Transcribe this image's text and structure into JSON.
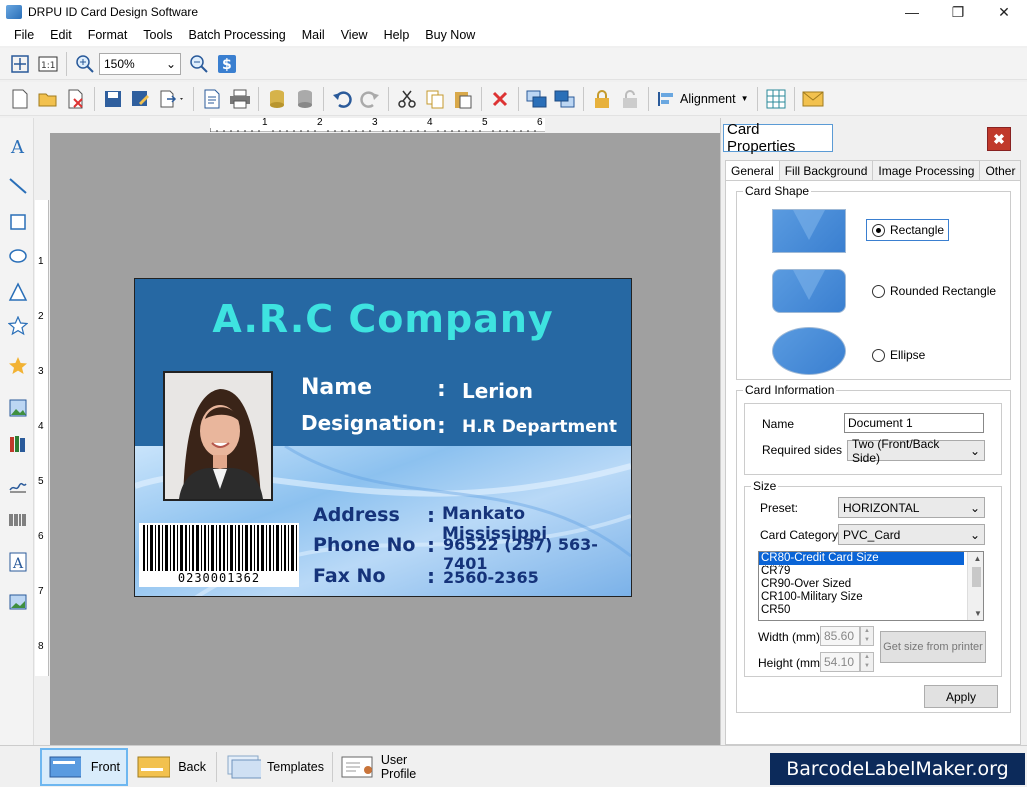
{
  "window": {
    "title": "DRPU ID Card Design Software"
  },
  "menu": [
    "File",
    "Edit",
    "Format",
    "Tools",
    "Batch Processing",
    "Mail",
    "View",
    "Help",
    "Buy Now"
  ],
  "toolbar": {
    "zoom": "150%",
    "alignment_label": "Alignment"
  },
  "ruler": {
    "h_marks": [
      "1",
      "2",
      "3",
      "4",
      "5",
      "6"
    ],
    "v_marks": [
      "1",
      "2",
      "3",
      "4",
      "5",
      "6",
      "7",
      "8"
    ]
  },
  "card": {
    "company": "A.R.C Company",
    "name_label": "Name",
    "name_value": "Lerion",
    "designation_label": "Designation",
    "designation_value": "H.R Department",
    "address_label": "Address",
    "address_value": "Mankato Mississippi",
    "phone_label": "Phone No",
    "phone_value": "96522 (257) 563-7401",
    "fax_label": "Fax No",
    "fax_value": "2560-2365",
    "colon": ":",
    "barcode_number": "0230001362"
  },
  "panel": {
    "title": "Card Properties",
    "tabs": [
      "General",
      "Fill Background",
      "Image Processing",
      "Other"
    ],
    "card_shape_legend": "Card Shape",
    "shapes": [
      "Rectangle",
      "Rounded Rectangle",
      "Ellipse"
    ],
    "selected_shape": "Rectangle",
    "card_info_legend": "Card Information",
    "name_label": "Name",
    "name_value": "Document 1",
    "required_sides_label": "Required sides",
    "required_sides_value": "Two (Front/Back Side)",
    "size_legend": "Size",
    "preset_label": "Preset:",
    "preset_value": "HORIZONTAL",
    "category_label": "Card Category",
    "category_value": "PVC_Card",
    "size_list": [
      "CR80-Credit Card Size",
      "CR79",
      "CR90-Over Sized",
      "CR100-Military Size",
      "CR50"
    ],
    "width_label": "Width  (mm)",
    "width_value": "85.60",
    "height_label": "Height  (mm)",
    "height_value": "54.10",
    "get_size_label": "Get size from printer",
    "apply_label": "Apply"
  },
  "bottom": {
    "front": "Front",
    "back": "Back",
    "templates": "Templates",
    "user_profile": "User Profile",
    "brand": "BarcodeLabelMaker.org"
  }
}
